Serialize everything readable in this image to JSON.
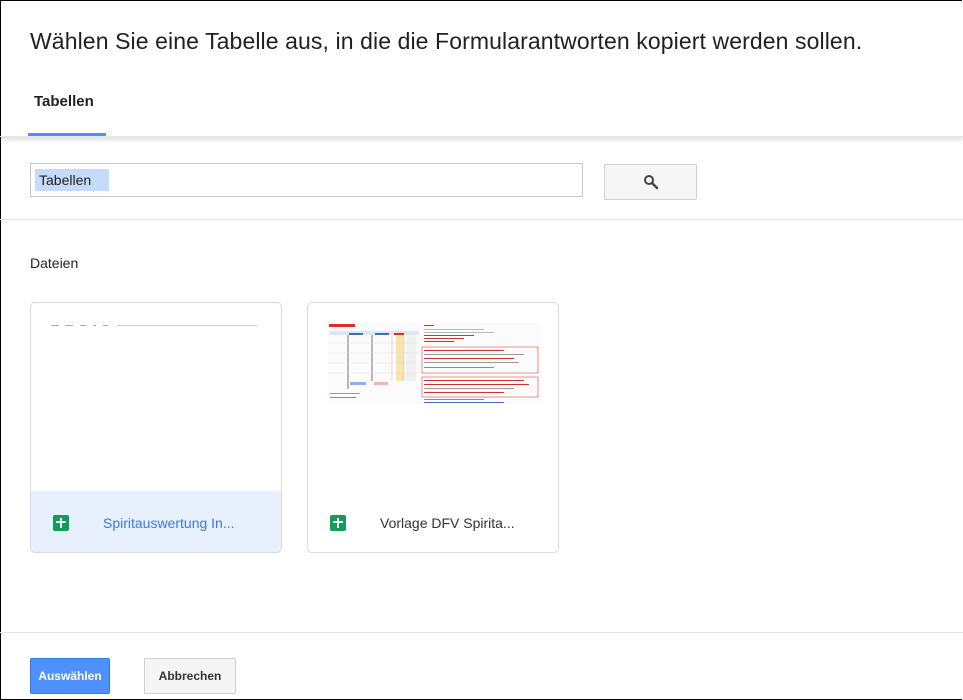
{
  "dialog": {
    "title": "Wählen Sie eine Tabelle aus, in die die Formularantworten kopiert werden sollen."
  },
  "tabs": [
    {
      "label": "Tabellen",
      "active": true
    }
  ],
  "search": {
    "value": "Tabellen",
    "button_icon": "search-icon"
  },
  "files_section": {
    "label": "Dateien",
    "files": [
      {
        "name": "Spiritauswertung In...",
        "icon": "google-sheets-icon",
        "selected": true
      },
      {
        "name": "Vorlage DFV Spirita...",
        "icon": "google-sheets-icon",
        "selected": false
      }
    ]
  },
  "actions": {
    "select_label": "Auswählen",
    "cancel_label": "Abbrechen"
  },
  "colors": {
    "accent": "#4d90fe",
    "selected_bg": "#e8f0fe",
    "selected_text": "#3b78e7",
    "sheets_green": "#0f9d58"
  }
}
